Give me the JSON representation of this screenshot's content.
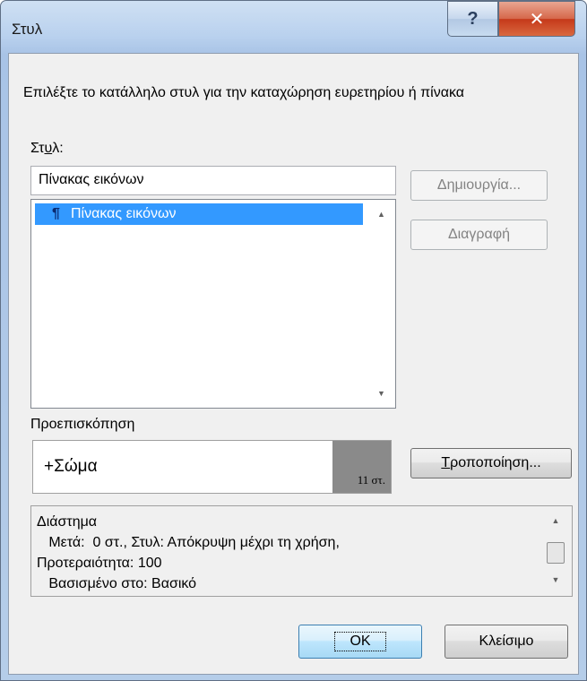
{
  "window": {
    "title": "Στυλ"
  },
  "instructions": "Επιλέξτε το κατάλληλο στυλ για την καταχώρηση ευρετηρίου ή πίνακα",
  "style_section": {
    "label_prefix": "Στ",
    "label_underline": "υ",
    "label_suffix": "λ:",
    "input_value": "Πίνακας εικόνων",
    "list_items": [
      {
        "label": "Πίνακας εικόνων",
        "marker": "¶",
        "selected": true
      }
    ]
  },
  "buttons": {
    "create": "Δημιουργία...",
    "delete": "Διαγραφή",
    "modify_underline": "Τ",
    "modify_rest": "ροποποίηση...",
    "ok": "OK",
    "close": "Κλείσιμο"
  },
  "preview": {
    "label": "Προεπισκόπηση",
    "text": "+Σώμα",
    "size": "11 στ."
  },
  "description": {
    "text": "Διάστημα\n   Μετά:  0 στ., Στυλ: Απόκρυψη μέχρι τη χρήση,\nΠροτεραιότητα: 100\n   Βασισμένο στο: Βασικό"
  },
  "icons": {
    "help": "help-icon",
    "close": "close-icon"
  }
}
